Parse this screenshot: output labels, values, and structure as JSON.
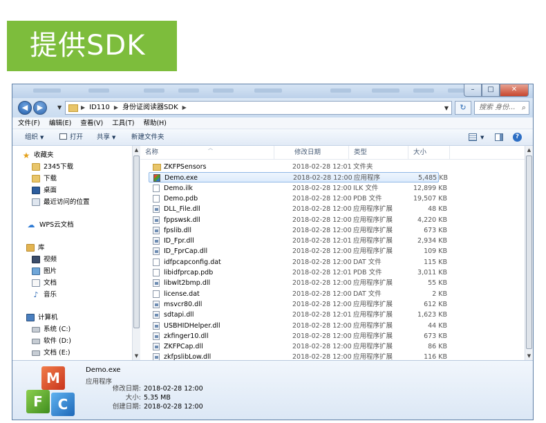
{
  "banner": {
    "title": "提供SDK"
  },
  "window": {
    "controls": {
      "minimize": "–",
      "maximize": "□",
      "close": "✕"
    },
    "address": {
      "segments": [
        "ID110",
        "身份证阅读器SDK"
      ],
      "search_placeholder": "搜索 身份..."
    },
    "menu": [
      "文件(F)",
      "编辑(E)",
      "查看(V)",
      "工具(T)",
      "帮助(H)"
    ],
    "toolbar": {
      "organize": "组织",
      "print": "打开",
      "share": "共享",
      "new_folder": "新建文件夹",
      "help": "?"
    },
    "nav": {
      "favorites": "收藏夹",
      "fav_items": [
        "2345下载",
        "下载",
        "桌面",
        "最近访问的位置"
      ],
      "wps": "WPS云文档",
      "library": "库",
      "lib_items": [
        "视频",
        "图片",
        "文档",
        "音乐"
      ],
      "computer": "计算机",
      "drives": [
        "系统 (C:)",
        "软件 (D:)",
        "文档 (E:)"
      ]
    },
    "columns": {
      "name": "名称",
      "date": "修改日期",
      "type": "类型",
      "size": "大小"
    },
    "files": [
      {
        "name": "ZKFPSensors",
        "date": "2018-02-28 12:01",
        "type": "文件夹",
        "size": "",
        "icon": "folder"
      },
      {
        "name": "Demo.exe",
        "date": "2018-02-28 12:00",
        "type": "应用程序",
        "size": "5,485 KB",
        "icon": "exe"
      },
      {
        "name": "Demo.ilk",
        "date": "2018-02-28 12:00",
        "type": "ILK 文件",
        "size": "12,899 KB",
        "icon": "file"
      },
      {
        "name": "Demo.pdb",
        "date": "2018-02-28 12:00",
        "type": "PDB 文件",
        "size": "19,507 KB",
        "icon": "file"
      },
      {
        "name": "DLL_File.dll",
        "date": "2018-02-28 12:00",
        "type": "应用程序扩展",
        "size": "48 KB",
        "icon": "dll"
      },
      {
        "name": "fppswsk.dll",
        "date": "2018-02-28 12:00",
        "type": "应用程序扩展",
        "size": "4,220 KB",
        "icon": "dll"
      },
      {
        "name": "fpslib.dll",
        "date": "2018-02-28 12:00",
        "type": "应用程序扩展",
        "size": "673 KB",
        "icon": "dll"
      },
      {
        "name": "ID_Fpr.dll",
        "date": "2018-02-28 12:01",
        "type": "应用程序扩展",
        "size": "2,934 KB",
        "icon": "dll"
      },
      {
        "name": "ID_FprCap.dll",
        "date": "2018-02-28 12:00",
        "type": "应用程序扩展",
        "size": "109 KB",
        "icon": "dll"
      },
      {
        "name": "idfpcapconfig.dat",
        "date": "2018-02-28 12:00",
        "type": "DAT 文件",
        "size": "115 KB",
        "icon": "file"
      },
      {
        "name": "libidfprcap.pdb",
        "date": "2018-02-28 12:01",
        "type": "PDB 文件",
        "size": "3,011 KB",
        "icon": "file"
      },
      {
        "name": "libwlt2bmp.dll",
        "date": "2018-02-28 12:00",
        "type": "应用程序扩展",
        "size": "55 KB",
        "icon": "dll"
      },
      {
        "name": "license.dat",
        "date": "2018-02-28 12:00",
        "type": "DAT 文件",
        "size": "2 KB",
        "icon": "file"
      },
      {
        "name": "msvcr80.dll",
        "date": "2018-02-28 12:00",
        "type": "应用程序扩展",
        "size": "612 KB",
        "icon": "dll"
      },
      {
        "name": "sdtapi.dll",
        "date": "2018-02-28 12:01",
        "type": "应用程序扩展",
        "size": "1,623 KB",
        "icon": "dll"
      },
      {
        "name": "USBHIDHelper.dll",
        "date": "2018-02-28 12:00",
        "type": "应用程序扩展",
        "size": "44 KB",
        "icon": "dll"
      },
      {
        "name": "zkfinger10.dll",
        "date": "2018-02-28 12:00",
        "type": "应用程序扩展",
        "size": "673 KB",
        "icon": "dll"
      },
      {
        "name": "ZKFPCap.dll",
        "date": "2018-02-28 12:00",
        "type": "应用程序扩展",
        "size": "86 KB",
        "icon": "dll"
      },
      {
        "name": "zkfpslibLow.dll",
        "date": "2018-02-28 12:00",
        "type": "应用程序扩展",
        "size": "116 KB",
        "icon": "dll"
      }
    ],
    "selected_index": 1,
    "details": {
      "name": "Demo.exe",
      "type": "应用程序",
      "rows": [
        {
          "label": "修改日期:",
          "value": "2018-02-28 12:00"
        },
        {
          "label": "大小:",
          "value": "5.35 MB"
        },
        {
          "label": "创建日期:",
          "value": "2018-02-28 12:00"
        }
      ],
      "logo_letters": [
        "M",
        "F",
        "C"
      ]
    }
  }
}
